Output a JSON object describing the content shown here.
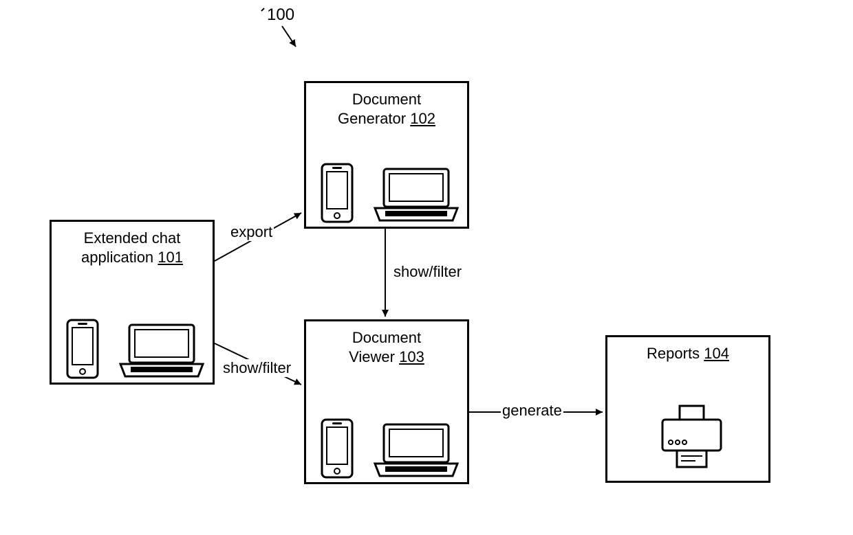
{
  "figure_ref": "100",
  "nodes": {
    "chat": {
      "title_line1": "Extended chat",
      "title_line2": "application",
      "ref": "101"
    },
    "generator": {
      "title_line1": "Document",
      "title_line2": "Generator",
      "ref": "102"
    },
    "viewer": {
      "title_line1": "Document",
      "title_line2": "Viewer",
      "ref": "103"
    },
    "reports": {
      "title": "Reports",
      "ref": "104"
    }
  },
  "edges": {
    "chat_to_generator": "export",
    "chat_to_viewer": "show/filter",
    "generator_to_viewer": "show/filter",
    "viewer_to_reports": "generate"
  }
}
